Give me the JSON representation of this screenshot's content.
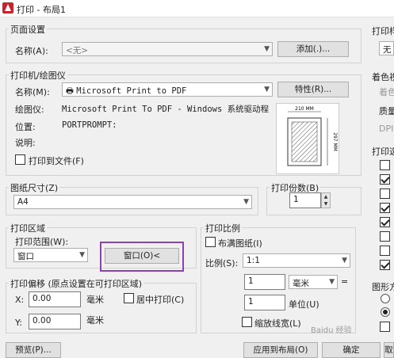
{
  "window": {
    "title": "打印 - 布局1"
  },
  "page_setup": {
    "group_label": "页面设置",
    "name_label": "名称(A):",
    "name_value": "<无>",
    "add_button": "添加(.)..."
  },
  "printer": {
    "group_label": "打印机/绘图仪",
    "name_label": "名称(M):",
    "name_value": "Microsoft Print to PDF",
    "properties_button": "特性(R)...",
    "plotter_label": "绘图仪:",
    "plotter_value": "Microsoft Print To PDF - Windows 系统驱动程...",
    "location_label": "位置:",
    "location_value": "PORTPROMPT:",
    "description_label": "说明:",
    "print_to_file": "打印到文件(F)",
    "preview_width": "210 MM",
    "preview_height": "297 MM"
  },
  "paper_size": {
    "group_label": "图纸尺寸(Z)",
    "value": "A4"
  },
  "copies": {
    "group_label": "打印份数(B)",
    "value": "1"
  },
  "plot_area": {
    "group_label": "打印区域",
    "range_label": "打印范围(W):",
    "range_value": "窗口",
    "window_button": "窗口(O)<"
  },
  "plot_offset": {
    "group_label": "打印偏移 (原点设置在可打印区域)",
    "x_label": "X:",
    "x_value": "0.00",
    "x_unit": "毫米",
    "y_label": "Y:",
    "y_value": "0.00",
    "y_unit": "毫米",
    "center_label": "居中打印(C)"
  },
  "plot_scale": {
    "group_label": "打印比例",
    "fit_label": "布满图纸(I)",
    "scale_label": "比例(S):",
    "scale_value": "1:1",
    "value1": "1",
    "unit1": "毫米",
    "equals": "=",
    "value2": "1",
    "unit2": "单位(U)",
    "lineweight_label": "缩放线宽(L)"
  },
  "right_panel": {
    "style_table_label": "打印样",
    "style_table_value": "无",
    "shaded_label": "着色视",
    "shaded_sub": "着色",
    "quality_label": "质量",
    "dpi_label": "DPI",
    "options_label": "打印选",
    "orientation_label": "图形方"
  },
  "footer": {
    "preview_button": "预览(P)...",
    "apply_button": "应用到布局(O)",
    "ok_button": "确定",
    "cancel_button": "取"
  },
  "watermark": "Baidu 经验"
}
